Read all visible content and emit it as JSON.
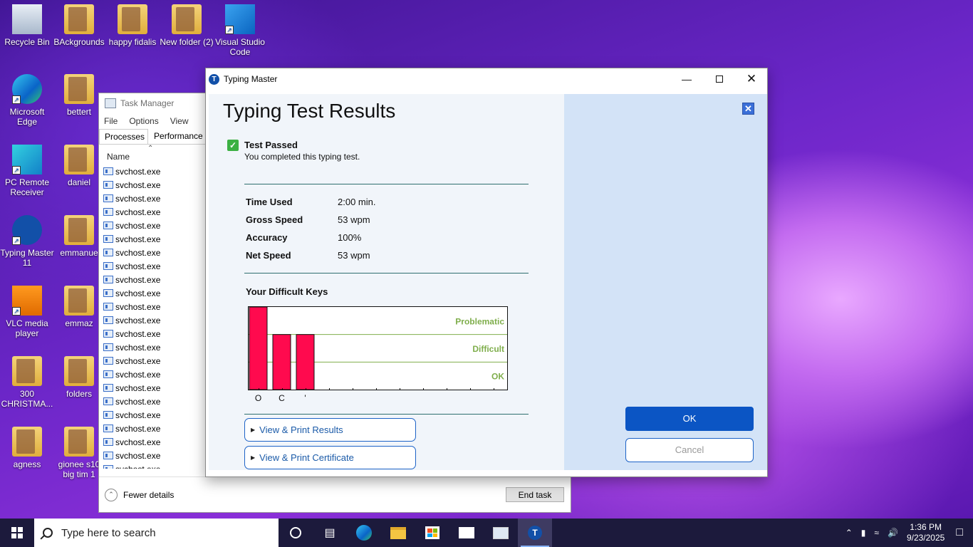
{
  "desktop_icons": [
    {
      "label": "Recycle Bin",
      "icon": "recycle-bin-icon"
    },
    {
      "label": "BAckgrounds",
      "icon": "folder-icon"
    },
    {
      "label": "happy fidalis",
      "icon": "folder-icon"
    },
    {
      "label": "New folder (2)",
      "icon": "folder-icon"
    },
    {
      "label": "Visual Studio Code",
      "icon": "vscode-icon"
    },
    {
      "label": "Microsoft Edge",
      "icon": "edge-icon"
    },
    {
      "label": "bettert",
      "icon": "folder-icon"
    },
    {
      "label": "PC Remote Receiver",
      "icon": "pc-remote-icon"
    },
    {
      "label": "daniel",
      "icon": "folder-icon"
    },
    {
      "label": "Typing Master 11",
      "icon": "typing-master-icon"
    },
    {
      "label": "emmanue",
      "icon": "folder-icon"
    },
    {
      "label": "VLC media player",
      "icon": "vlc-icon"
    },
    {
      "label": "emmaz",
      "icon": "folder-icon"
    },
    {
      "label": "300 CHRISTMA...",
      "icon": "folder-icon"
    },
    {
      "label": "folders",
      "icon": "folder-icon"
    },
    {
      "label": "agness",
      "icon": "folder-icon"
    },
    {
      "label": "gionee s10 big tim 1",
      "icon": "folder-icon"
    }
  ],
  "task_manager": {
    "title": "Task Manager",
    "menu": [
      "File",
      "Options",
      "View"
    ],
    "tabs": [
      "Processes",
      "Performance"
    ],
    "column_name": "Name",
    "processes": [
      "svchost.exe",
      "svchost.exe",
      "svchost.exe",
      "svchost.exe",
      "svchost.exe",
      "svchost.exe",
      "svchost.exe",
      "svchost.exe",
      "svchost.exe",
      "svchost.exe",
      "svchost.exe",
      "svchost.exe",
      "svchost.exe",
      "svchost.exe",
      "svchost.exe",
      "svchost.exe",
      "svchost.exe",
      "svchost.exe",
      "svchost.exe",
      "svchost.exe",
      "svchost.exe",
      "svchost.exe",
      "svchost.exe"
    ],
    "fewer_details": "Fewer details",
    "end_task": "End task"
  },
  "typing_master": {
    "window_title": "Typing Master",
    "heading": "Typing Test Results",
    "status_title": "Test Passed",
    "status_sub": "You completed this typing test.",
    "stats": [
      {
        "label": "Time Used",
        "value": "2:00 min."
      },
      {
        "label": "Gross Speed",
        "value": "53 wpm"
      },
      {
        "label": "Accuracy",
        "value": "100%"
      },
      {
        "label": "Net Speed",
        "value": "53 wpm"
      }
    ],
    "difficult_keys_title": "Your Difficult Keys",
    "link_results": "View & Print Results",
    "link_certificate": "View & Print Certificate",
    "ok": "OK",
    "cancel": "Cancel"
  },
  "chart_data": {
    "type": "bar",
    "categories": [
      "O",
      "C",
      "'"
    ],
    "values": [
      3,
      2,
      2
    ],
    "slots": 11,
    "ylim": [
      0,
      3
    ],
    "zones": [
      "Problematic",
      "Difficult",
      "OK"
    ],
    "colors": {
      "bar": "#ff0a4e",
      "zone_text": "#7fae4c",
      "zone_line": "#7fae4c"
    }
  },
  "taskbar": {
    "search_placeholder": "Type here to search",
    "time": "1:36 PM",
    "date": "9/23/2025"
  }
}
